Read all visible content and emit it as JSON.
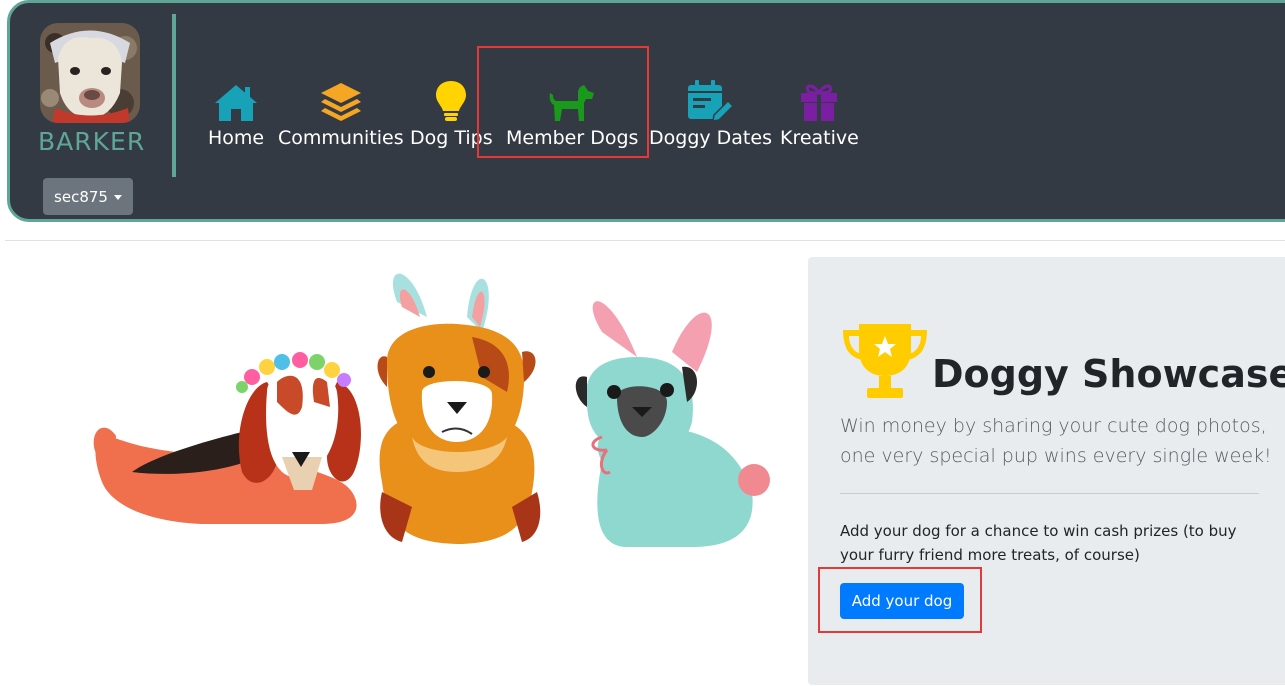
{
  "brand": {
    "name": "BARKER"
  },
  "user_menu": {
    "label": "sec875"
  },
  "nav": [
    {
      "label": "Home",
      "icon": "home-icon",
      "color": "#17a2b8"
    },
    {
      "label": "Communities",
      "icon": "layers-icon",
      "color": "#f5a623"
    },
    {
      "label": "Dog Tips",
      "icon": "lightbulb-icon",
      "color": "#ffd400"
    },
    {
      "label": "Member Dogs",
      "icon": "dog-icon",
      "color": "#1f9a1f"
    },
    {
      "label": "Doggy Dates",
      "icon": "calendar-edit-icon",
      "color": "#17a2b8"
    },
    {
      "label": "Kreative",
      "icon": "gift-icon",
      "color": "#7a1fa2"
    }
  ],
  "showcase": {
    "title": "Doggy Showcase",
    "lead": "Win money by sharing your cute dog photos, one very special pup wins every single week!",
    "body": "Add your dog for a chance to win cash prizes (to buy your furry friend more treats, of course)",
    "button": "Add your dog"
  },
  "colors": {
    "header_bg": "#343a44",
    "accent": "#5fa696",
    "primary": "#007bff",
    "highlight": "#e53838"
  }
}
